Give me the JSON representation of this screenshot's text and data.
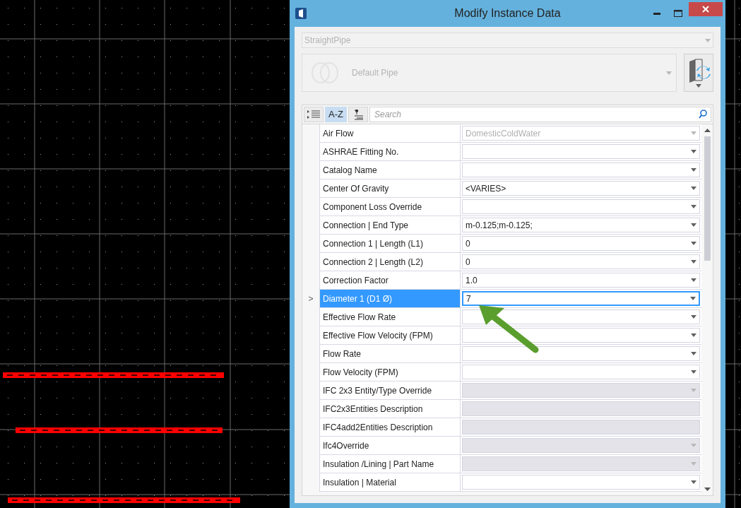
{
  "window": {
    "title": "Modify Instance Data"
  },
  "class_selector": {
    "value": "StraightPipe",
    "disabled": true
  },
  "spec_selector": {
    "value": "Default Pipe",
    "disabled": true
  },
  "toolbar": [
    {
      "kind": "categorized",
      "selected": false
    },
    {
      "kind": "alphabetical",
      "label": "A-Z",
      "selected": true
    },
    {
      "kind": "filter",
      "selected": false
    }
  ],
  "search": {
    "placeholder": "Search"
  },
  "properties": [
    {
      "name": "Air Flow",
      "value": "DomesticColdWater",
      "kind": "dropdown",
      "readonly": true,
      "disabled": false,
      "selected": false
    },
    {
      "name": "ASHRAE Fitting No.",
      "kind": "dropdown",
      "disabled": false,
      "selected": false
    },
    {
      "name": "Catalog Name",
      "kind": "dropdown",
      "disabled": false,
      "selected": false
    },
    {
      "name": "Center Of Gravity",
      "value": "<VARIES>",
      "kind": "dropdown",
      "disabled": false,
      "selected": false
    },
    {
      "name": "Component Loss Override",
      "kind": "dropdown",
      "disabled": false,
      "selected": false
    },
    {
      "name": "Connection | End Type",
      "value": "m-0.125;m-0.125;",
      "kind": "dropdown",
      "disabled": false,
      "selected": false
    },
    {
      "name": "Connection 1 | Length (L1)",
      "value": "0",
      "kind": "dropdown",
      "disabled": false,
      "selected": false
    },
    {
      "name": "Connection 2 | Length (L2)",
      "value": "0",
      "kind": "dropdown",
      "disabled": false,
      "selected": false
    },
    {
      "name": "Correction Factor",
      "value": "1.0",
      "kind": "dropdown",
      "disabled": false,
      "selected": false
    },
    {
      "name": "Diameter 1 (D1 Ø)",
      "value": "7",
      "kind": "dropdown",
      "disabled": false,
      "selected": true
    },
    {
      "name": "Effective Flow Rate",
      "kind": "dropdown",
      "disabled": false,
      "selected": false
    },
    {
      "name": "Effective Flow Velocity (FPM)",
      "kind": "dropdown",
      "disabled": false,
      "selected": false
    },
    {
      "name": "Flow Rate",
      "kind": "dropdown",
      "disabled": false,
      "selected": false
    },
    {
      "name": "Flow Velocity (FPM)",
      "kind": "dropdown",
      "disabled": false,
      "selected": false
    },
    {
      "name": "IFC 2x3 Entity/Type Override",
      "kind": "dropdown",
      "disabled": true,
      "selected": false
    },
    {
      "name": "IFC2x3Entities Description",
      "kind": "text",
      "disabled": true,
      "selected": false
    },
    {
      "name": "IFC4add2Entities Description",
      "kind": "text",
      "disabled": true,
      "selected": false
    },
    {
      "name": "Ifc4Override",
      "kind": "dropdown",
      "disabled": true,
      "selected": false
    },
    {
      "name": "Insulation /Lining | Part Name",
      "kind": "dropdown",
      "disabled": true,
      "selected": false
    },
    {
      "name": "Insulation | Material",
      "kind": "dropdown",
      "disabled": false,
      "selected": false
    }
  ],
  "selected_marker": ">"
}
